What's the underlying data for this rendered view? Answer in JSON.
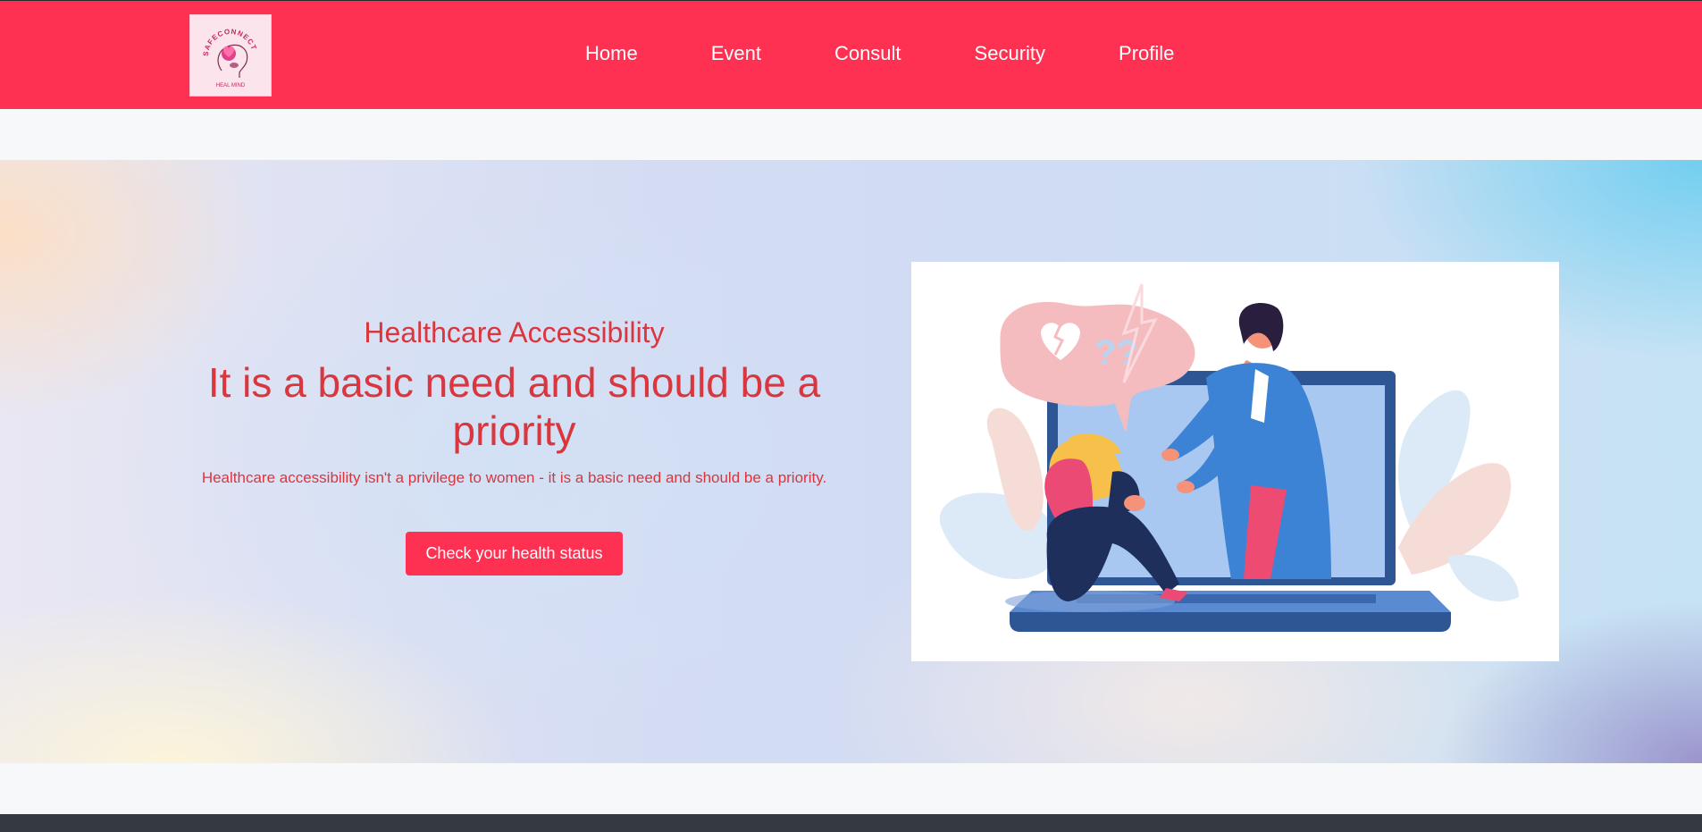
{
  "brand": {
    "logo_text": "SAFECONNECT",
    "logo_subtext": "HEAL MIND",
    "colors": {
      "primary": "#ff3153",
      "accent_text": "#d9363e",
      "footer": "#343a40"
    }
  },
  "nav": {
    "items": [
      {
        "label": "Home"
      },
      {
        "label": "Event"
      },
      {
        "label": "Consult"
      },
      {
        "label": "Security"
      },
      {
        "label": "Profile"
      }
    ]
  },
  "hero": {
    "eyebrow": "Healthcare Accessibility",
    "headline": "It is a basic need and should be a priority",
    "description": "Healthcare accessibility isn't a privilege to women - it is a basic need and should be a priority.",
    "cta_label": "Check your health status",
    "illustration": "counselor-supporting-woman-illustration"
  }
}
